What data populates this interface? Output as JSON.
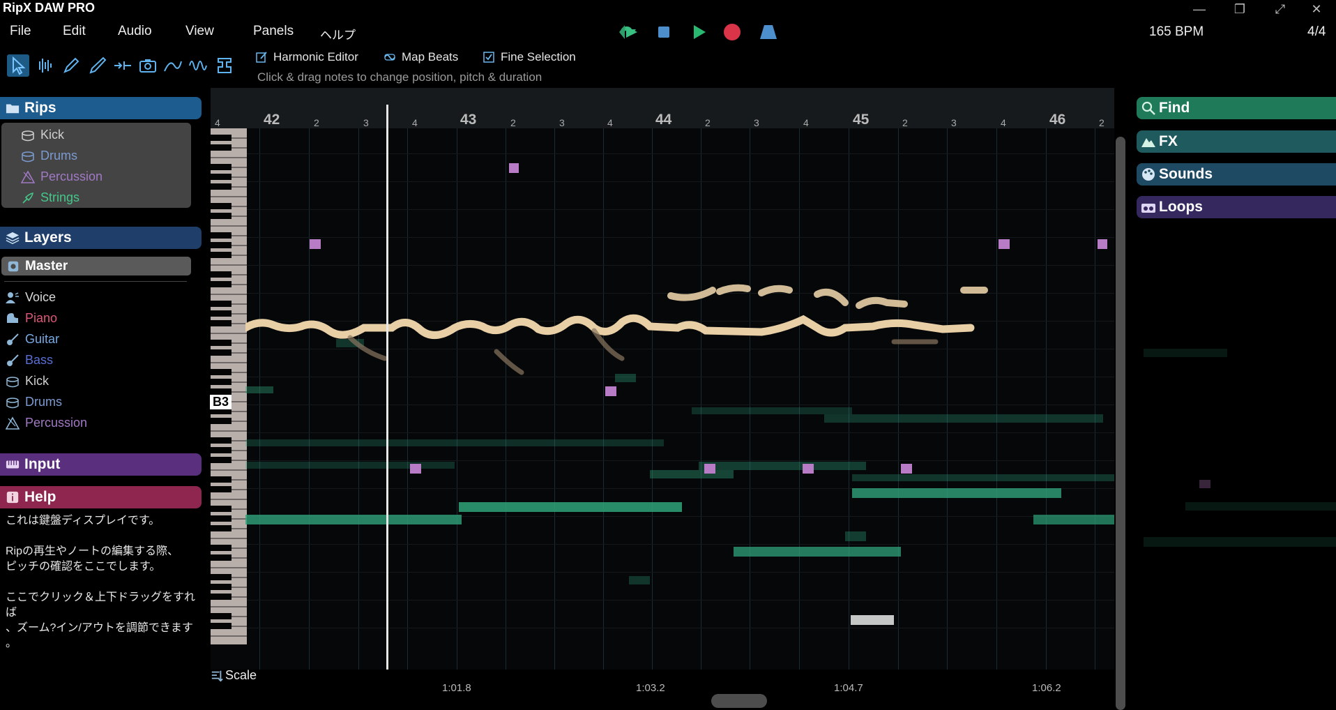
{
  "app": {
    "title": "RipX DAW PRO"
  },
  "window": {
    "minimize": "—",
    "restore": "❐",
    "maximize": "⤢",
    "close": "✕"
  },
  "menu": [
    "File",
    "Edit",
    "Audio",
    "View",
    "Panels",
    "ヘルプ"
  ],
  "transport": {
    "bpm": "165 BPM",
    "time_signature": "4/4"
  },
  "modes": {
    "harmonic_editor": "Harmonic Editor",
    "map_beats": "Map Beats",
    "fine_selection": "Fine Selection"
  },
  "hint": "Click & drag notes to change position, pitch & duration",
  "left_panel": {
    "rips": {
      "title": "Rips",
      "items": [
        {
          "label": "Kick",
          "color": "#cfcfcf"
        },
        {
          "label": "Drums",
          "color": "#7b9bd0"
        },
        {
          "label": "Percussion",
          "color": "#a179c4"
        },
        {
          "label": "Strings",
          "color": "#45c78a"
        }
      ]
    },
    "layers": {
      "title": "Layers",
      "master": "Master",
      "items": [
        {
          "label": "Voice",
          "color": "#d9d9d9"
        },
        {
          "label": "Piano",
          "color": "#e0567a"
        },
        {
          "label": "Guitar",
          "color": "#76a9e2"
        },
        {
          "label": "Bass",
          "color": "#5a6ed6"
        },
        {
          "label": "Kick",
          "color": "#cfcfcf"
        },
        {
          "label": "Drums",
          "color": "#7b9bd0"
        },
        {
          "label": "Percussion",
          "color": "#a179c4"
        }
      ]
    },
    "input": {
      "title": "Input"
    },
    "help": {
      "title": "Help",
      "paragraphs": [
        "これは鍵盤ディスプレイです。",
        "Ripの再生やノートの編集する際、\nピッチの確認をここでします。",
        "ここでクリック＆上下ドラッグをすれば\n、ズーム?イン/アウトを調節できます\n。"
      ]
    }
  },
  "editor": {
    "bars": [
      "42",
      "43",
      "44",
      "45",
      "46"
    ],
    "beat_labels": [
      "4",
      "2",
      "3",
      "4",
      "2",
      "3",
      "4",
      "2",
      "3",
      "4",
      "2",
      "3",
      "4",
      "2"
    ],
    "pitch_label": "B3",
    "time_labels": [
      "1:01.8",
      "1:03.2",
      "1:04.7",
      "1:06.2"
    ],
    "scale_button": "Scale"
  },
  "right_panel": {
    "find": "Find",
    "fx": "FX",
    "sounds": "Sounds",
    "loops": "Loops"
  },
  "colors": {
    "rips": "#1d5c8e",
    "layers": "#1f3f6a",
    "input": "#5a2f7d",
    "help": "#8e2650",
    "find": "#1f7a5a",
    "fx": "#1e5a5e",
    "sounds": "#1f4a63",
    "loops": "#34285e",
    "voice_note": "#e8cfa6",
    "strings_note": "#2fa37a",
    "percussion_note": "#b87cc7"
  }
}
